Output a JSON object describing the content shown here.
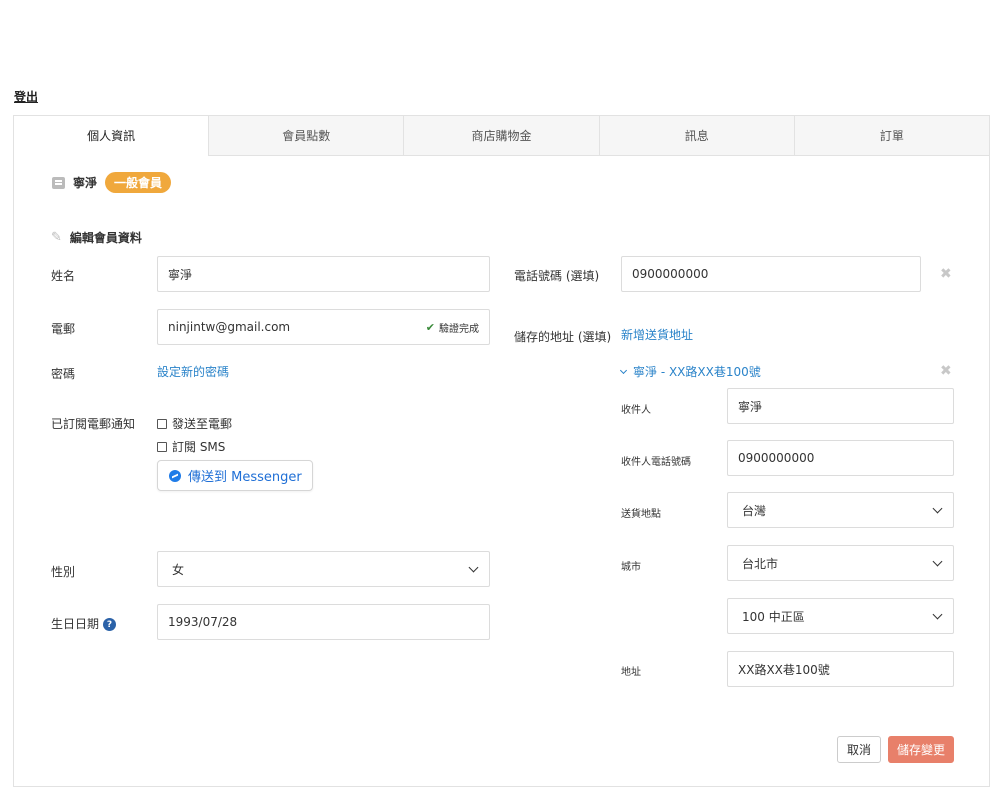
{
  "header": {
    "logout_label": "登出"
  },
  "tabs": [
    {
      "label": "個人資訊",
      "active": true
    },
    {
      "label": "會員點數"
    },
    {
      "label": "商店購物金"
    },
    {
      "label": "訊息"
    },
    {
      "label": "訂單"
    }
  ],
  "member": {
    "name": "寧淨",
    "tier_badge": "一般會員"
  },
  "profile": {
    "section_title": "編輯會員資料",
    "name_label": "姓名",
    "name_value": "寧淨",
    "email_label": "電郵",
    "email_value": "ninjintw@gmail.com",
    "email_verified_label": "驗證完成",
    "password_label": "密碼",
    "password_link": "設定新的密碼",
    "subscription_label": "已訂閱電郵通知",
    "subscribe_email_label": "發送至電郵",
    "subscribe_sms_label": "訂閱 SMS",
    "messenger_button": "傳送到 Messenger",
    "gender_label": "性別",
    "gender_value": "女",
    "birthday_label": "生日日期",
    "birthday_value": "1993/07/28"
  },
  "contact": {
    "phone_label": "電話號碼 (選填)",
    "phone_value": "0900000000",
    "saved_address_label": "儲存的地址 (選填)",
    "add_address_link": "新增送貨地址"
  },
  "address": {
    "summary": "寧淨 - XX路XX巷100號",
    "recipient_label": "收件人",
    "recipient_value": "寧淨",
    "recipient_phone_label": "收件人電話號碼",
    "recipient_phone_value": "0900000000",
    "delivery_location_label": "送貨地點",
    "delivery_location_value": "台灣",
    "city_label": "城市",
    "city_value": "台北市",
    "district_value": "100 中正區",
    "street_label": "地址",
    "street_value": "XX路XX巷100號"
  },
  "actions": {
    "cancel_label": "取消",
    "save_label": "儲存變更"
  },
  "colors": {
    "accent_link": "#2a83c9",
    "badge": "#f0a83c",
    "save_button": "#e8806a",
    "verified_check": "#3a8a3a",
    "help_icon": "#2b62a8",
    "messenger": "#1f7ce8"
  },
  "icons": [
    "id-card-icon",
    "pencil-icon",
    "check-icon",
    "messenger-icon",
    "help-icon",
    "remove-icon",
    "chevron-down-icon"
  ]
}
